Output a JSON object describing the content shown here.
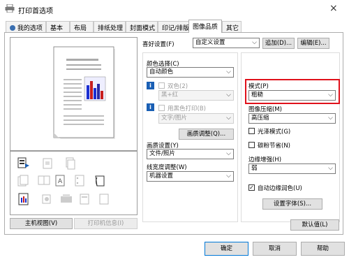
{
  "window": {
    "title": "打印首选项",
    "close_glyph": "×"
  },
  "tabs": [
    "我的选项",
    "基本",
    "布局",
    "排纸处理",
    "封面模式",
    "印记/排版",
    "图像品质",
    "其它"
  ],
  "top": {
    "favorite_label": "喜好设置(F)",
    "favorite_value": "自定义设置",
    "add_btn": "追加(D)...",
    "edit_btn": "编辑(E)..."
  },
  "color": {
    "label": "颜色选择(C)",
    "value": "自动颜色",
    "twocolor_label": "双色(2)",
    "twocolor_value": "黑+红",
    "blackprint_label": "用黑色打印(B)",
    "blackprint_value": "文字/图片",
    "quality_btn": "画质调整(Q)..."
  },
  "image_setting": {
    "label": "画质设置(Y)",
    "value": "文件/照片"
  },
  "line_width": {
    "label": "线宽度调整(W)",
    "value": "机器设置"
  },
  "mode": {
    "label": "模式(P)",
    "value": "粗糙"
  },
  "compression": {
    "label": "图像压缩(M)",
    "value": "高压缩"
  },
  "gloss": {
    "label": "光泽模式(G)"
  },
  "toner_save": {
    "label": "碳粉节省(N)"
  },
  "edge": {
    "label": "边缘增强(H)",
    "value": "弱"
  },
  "auto_trap": {
    "label": "自动边缘润色(U)"
  },
  "font_btn": "设置字体(S)...",
  "default_btn": "默认值(L)",
  "view_btns": {
    "host": "主机视图(V)",
    "printer_info": "打印机信息(I)"
  },
  "footer": {
    "ok": "确定",
    "cancel": "取消",
    "help": "帮助"
  },
  "icons": {
    "info": "i",
    "check": "✓",
    "dropdown": "⌵"
  }
}
